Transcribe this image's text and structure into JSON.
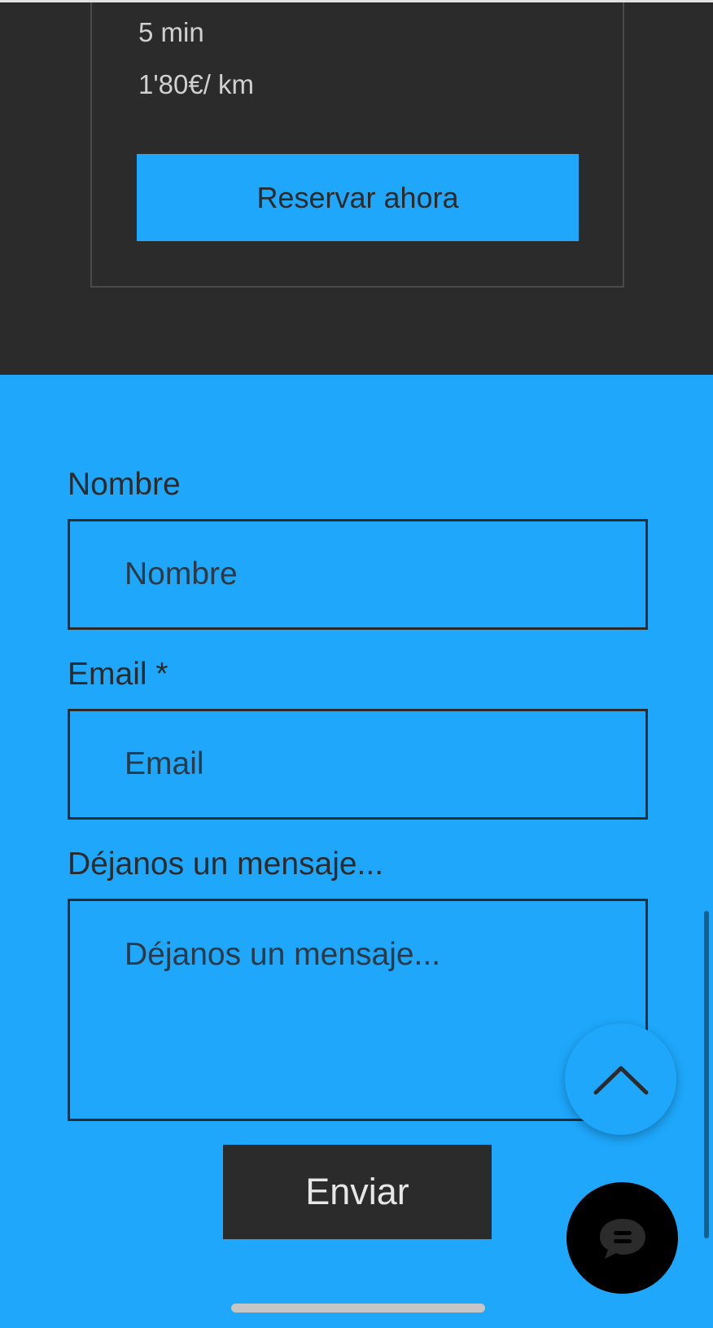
{
  "pricing_card": {
    "duration": "5 min",
    "price_per_km": "1'80€/ km",
    "reserve_label": "Reservar ahora"
  },
  "contact_form": {
    "name": {
      "label": "Nombre",
      "placeholder": "Nombre",
      "value": ""
    },
    "email": {
      "label": "Email *",
      "placeholder": "Email",
      "value": ""
    },
    "message": {
      "label": "Déjanos un mensaje...",
      "placeholder": "Déjanos un mensaje...",
      "value": ""
    },
    "submit_label": "Enviar"
  },
  "floating_actions": {
    "scroll_top_icon": "chevron-up-icon",
    "chat_icon": "chat-bubble-icon"
  },
  "colors": {
    "dark_background": "#2b2b2b",
    "accent_blue": "#1ea7fb",
    "chat_button": "#000000",
    "scrollbar": "#13608f"
  }
}
